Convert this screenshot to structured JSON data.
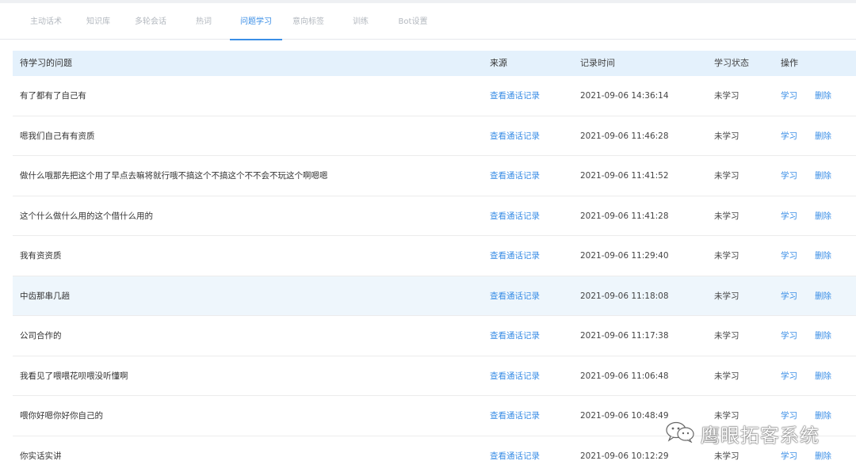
{
  "tabs": [
    {
      "label": "主动话术",
      "active": false
    },
    {
      "label": "知识库",
      "active": false
    },
    {
      "label": "多轮会话",
      "active": false
    },
    {
      "label": "热词",
      "active": false
    },
    {
      "label": "问题学习",
      "active": true
    },
    {
      "label": "意向标签",
      "active": false
    },
    {
      "label": "训练",
      "active": false
    },
    {
      "label": "Bot设置",
      "active": false
    }
  ],
  "table": {
    "headers": {
      "question": "待学习的问题",
      "source": "来源",
      "time": "记录时间",
      "status": "学习状态",
      "actions": "操作"
    },
    "rows": [
      {
        "question": "有了都有了自己有",
        "source": "查看通话记录",
        "time": "2021-09-06 14:36:14",
        "status": "未学习",
        "learn": "学习",
        "delete": "删除"
      },
      {
        "question": "嗯我们自己有有资质",
        "source": "查看通话记录",
        "time": "2021-09-06 11:46:28",
        "status": "未学习",
        "learn": "学习",
        "delete": "删除"
      },
      {
        "question": "做什么哦那先把这个用了早点去嘛将就行哦不搞这个不搞这个不不会不玩这个啊嗯嗯",
        "source": "查看通话记录",
        "time": "2021-09-06 11:41:52",
        "status": "未学习",
        "learn": "学习",
        "delete": "删除"
      },
      {
        "question": "这个什么做什么用的这个借什么用的",
        "source": "查看通话记录",
        "time": "2021-09-06 11:41:28",
        "status": "未学习",
        "learn": "学习",
        "delete": "删除"
      },
      {
        "question": "我有资资质",
        "source": "查看通话记录",
        "time": "2021-09-06 11:29:40",
        "status": "未学习",
        "learn": "学习",
        "delete": "删除"
      },
      {
        "question": "中齿那串几趟",
        "source": "查看通话记录",
        "time": "2021-09-06 11:18:08",
        "status": "未学习",
        "learn": "学习",
        "delete": "删除"
      },
      {
        "question": "公司合作的",
        "source": "查看通话记录",
        "time": "2021-09-06 11:17:38",
        "status": "未学习",
        "learn": "学习",
        "delete": "删除"
      },
      {
        "question": "我看见了喂喂花呗喂没听懂啊",
        "source": "查看通话记录",
        "time": "2021-09-06 11:06:48",
        "status": "未学习",
        "learn": "学习",
        "delete": "删除"
      },
      {
        "question": "喂你好嗯你好你自己的",
        "source": "查看通话记录",
        "time": "2021-09-06 10:48:49",
        "status": "未学习",
        "learn": "学习",
        "delete": "删除"
      },
      {
        "question": "你实话实讲",
        "source": "查看通话记录",
        "time": "2021-09-06 10:12:29",
        "status": "未学习",
        "learn": "学习",
        "delete": "删除"
      }
    ]
  },
  "watermark": {
    "text": "鹰眼拓客系统",
    "icon": "wechat-icon"
  },
  "colors": {
    "accent": "#3a8ee6",
    "header_bg": "#e4f1fc",
    "highlight_row_bg": "#eef6fc"
  }
}
